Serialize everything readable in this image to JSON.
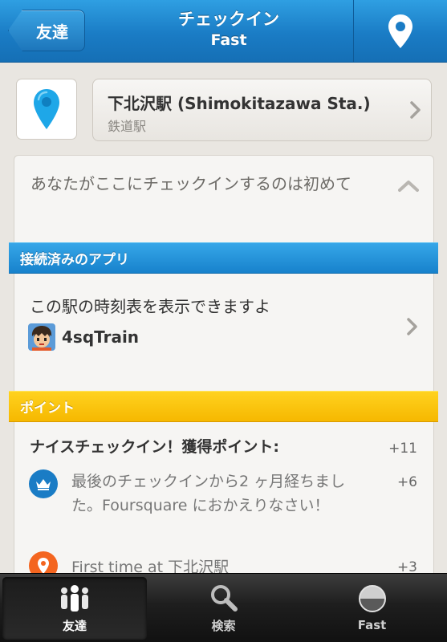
{
  "navbar": {
    "back_label": "友達",
    "title": "チェックイン",
    "subtitle": "Fast"
  },
  "venue": {
    "name": "下北沢駅 (Shimokitazawa Sta.)",
    "category": "鉄道駅"
  },
  "first_checkin_text": "あなたがここにチェックインするのは初めて",
  "connected_apps": {
    "header": "接続済みのアプリ",
    "description": "この駅の時刻表を表示できますよ",
    "app_name": "4sqTrain"
  },
  "points": {
    "header": "ポイント",
    "title": "ナイスチェックイン！獲得ポイント:",
    "total": "+11",
    "items": [
      {
        "text": "最後のチェックインから2 ヶ月経ちました。Foursquare におかえりなさい！",
        "value": "+6",
        "icon": "crown-icon"
      },
      {
        "text": "First time at 下北沢駅",
        "value": "+3",
        "icon": "location-pin-icon"
      }
    ]
  },
  "tabbar": {
    "tabs": [
      {
        "label": "友達",
        "icon": "friends-icon",
        "active": true
      },
      {
        "label": "検索",
        "icon": "search-icon",
        "active": false
      },
      {
        "label": "Fast",
        "icon": "profile-avatar-icon",
        "active": false
      }
    ]
  },
  "colors": {
    "nav_blue": "#1a7cc5",
    "section_blue": "#1782cc",
    "section_yellow": "#f6b800",
    "pin_cyan": "#1ea7e8",
    "points_orange": "#f4651f"
  }
}
